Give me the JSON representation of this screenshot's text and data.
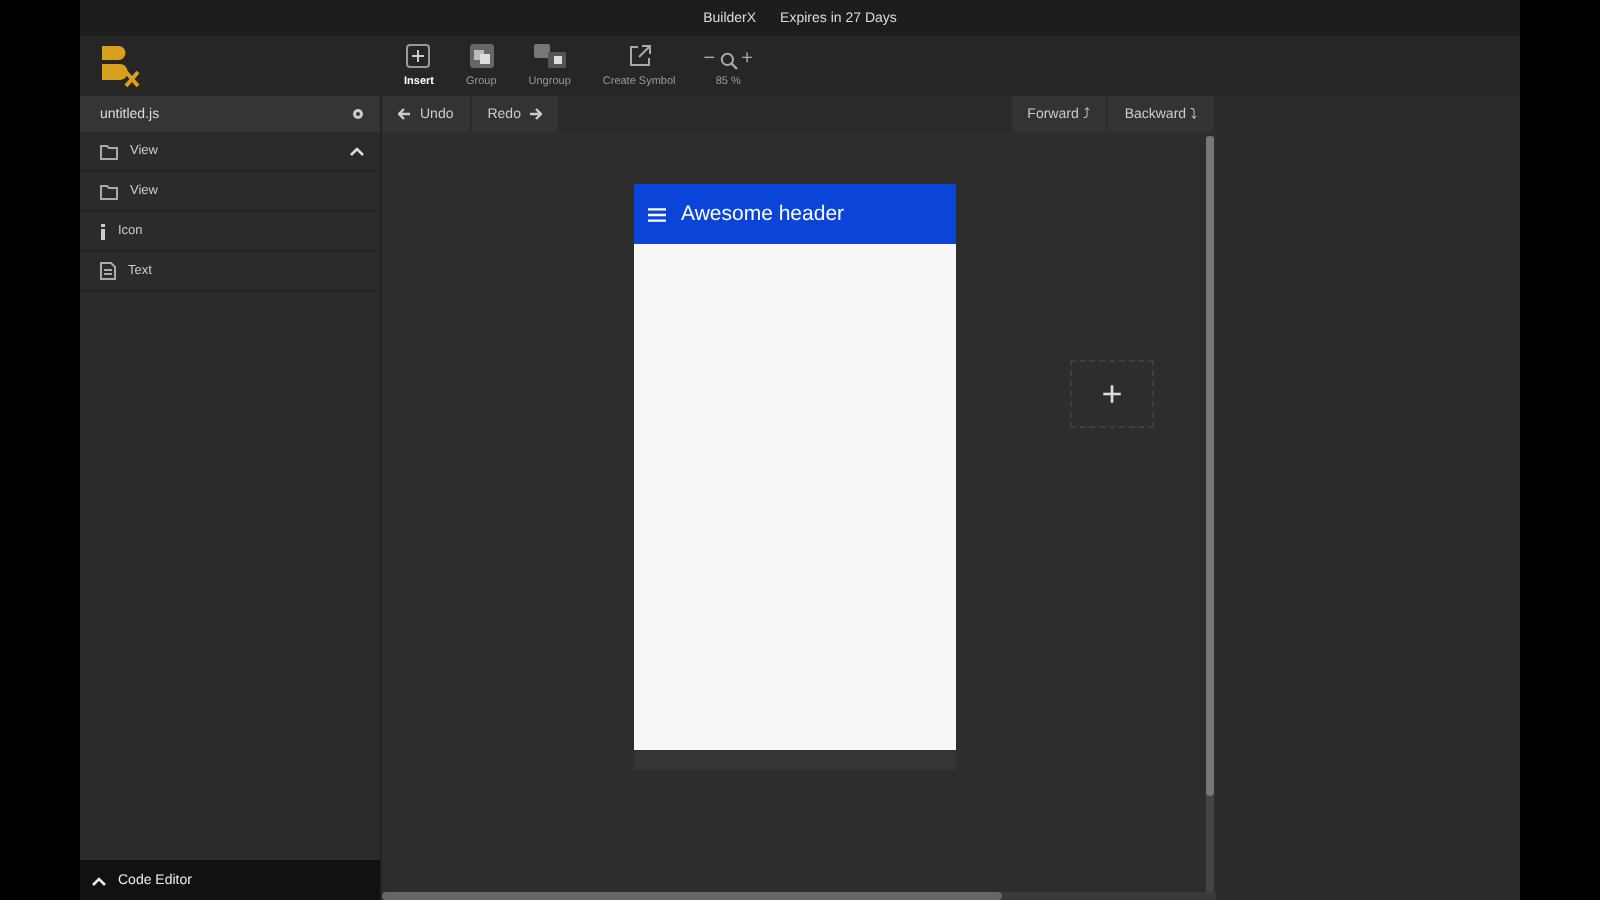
{
  "window": {
    "title": "BuilderX",
    "license": "Expires in 27 Days"
  },
  "toolbar": {
    "tools": [
      {
        "kind": "insert",
        "label": "Insert",
        "selected": true
      },
      {
        "kind": "group",
        "label": "Group",
        "selected": false
      },
      {
        "kind": "ungroup",
        "label": "Ungroup",
        "selected": false
      },
      {
        "kind": "symbol",
        "label": "Create Symbol",
        "selected": false
      }
    ],
    "zoom": {
      "minus": "−",
      "plus": "+",
      "reading": "85 %"
    }
  },
  "sidebar": {
    "file": "untitled.js",
    "items": [
      {
        "kind": "folder",
        "label": "View",
        "expanded": true
      },
      {
        "kind": "folder",
        "label": "View",
        "expanded": false
      },
      {
        "kind": "info",
        "label": "Icon",
        "expanded": false
      },
      {
        "kind": "file",
        "label": "Text",
        "expanded": false
      }
    ],
    "code_editor": "Code Editor"
  },
  "history": {
    "undo": "Undo",
    "redo": "Redo"
  },
  "layers": {
    "forward": "Forward",
    "forward_key": "⤴",
    "backward": "Backward",
    "backward_key": "⤵"
  },
  "canvas": {
    "screen_header": "Awesome header",
    "add_button": "+"
  }
}
